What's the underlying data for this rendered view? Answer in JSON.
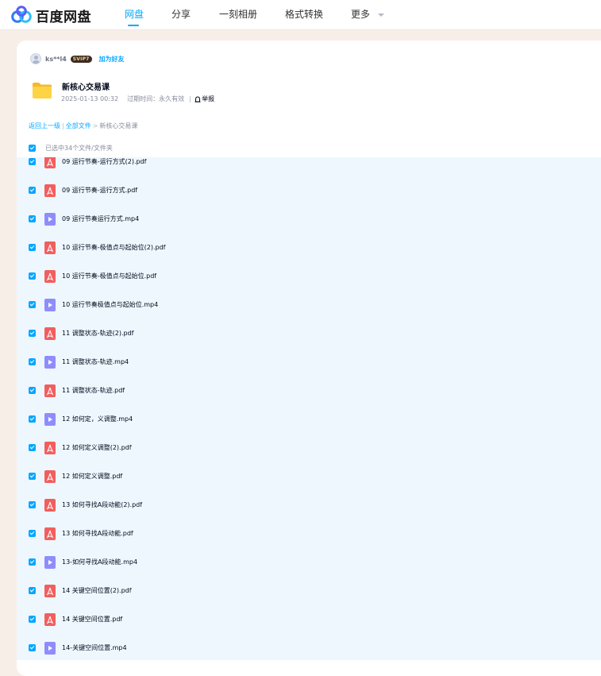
{
  "app": {
    "logo_text": "百度网盘",
    "nav": [
      {
        "label": "网盘",
        "active": true
      },
      {
        "label": "分享",
        "active": false
      },
      {
        "label": "一刻相册",
        "active": false
      },
      {
        "label": "格式转换",
        "active": false
      },
      {
        "label": "更多",
        "active": false
      }
    ]
  },
  "share": {
    "owner": "ks**l4",
    "vip_badge": "SVIP7",
    "add_friend": "加为好友",
    "folder_title": "新核心交易课",
    "date": "2025-01-13 00:32",
    "expiry_label": "过期时间：永久有效",
    "report_label": "举报"
  },
  "breadcrumb": {
    "back": "返回上一级",
    "all_files": "全部文件",
    "current": "新核心交易课"
  },
  "selection": {
    "text": "已选中34个文件/文件夹"
  },
  "colors": {
    "accent": "#06a7ff",
    "pdf_icon": "#f25e5e",
    "video_icon": "#8f8dfc",
    "list_bg": "#eef7fe",
    "page_bg": "#f7eee8"
  },
  "files": [
    {
      "name": "09 运行节奏-运行方式(2).pdf",
      "type": "pdf",
      "checked": true
    },
    {
      "name": "09 运行节奏-运行方式.pdf",
      "type": "pdf",
      "checked": true
    },
    {
      "name": "09 运行节奏运行方式.mp4",
      "type": "video",
      "checked": true
    },
    {
      "name": "10 运行节奏-极值点与起始位(2).pdf",
      "type": "pdf",
      "checked": true
    },
    {
      "name": "10 运行节奏-极值点与起始位.pdf",
      "type": "pdf",
      "checked": true
    },
    {
      "name": "10 运行节奏极值点与起始位.mp4",
      "type": "video",
      "checked": true
    },
    {
      "name": "11 调整状态-轨迹(2).pdf",
      "type": "pdf",
      "checked": true
    },
    {
      "name": "11 调整状态-轨迹.mp4",
      "type": "video",
      "checked": true
    },
    {
      "name": "11 调整状态-轨迹.pdf",
      "type": "pdf",
      "checked": true
    },
    {
      "name": "12 如何定，义调整.mp4",
      "type": "video",
      "checked": true
    },
    {
      "name": "12 如何定义调整(2).pdf",
      "type": "pdf",
      "checked": true
    },
    {
      "name": "12 如何定义调整.pdf",
      "type": "pdf",
      "checked": true
    },
    {
      "name": "13 如何寻找A段动能(2).pdf",
      "type": "pdf",
      "checked": true
    },
    {
      "name": "13 如何寻找A段动能.pdf",
      "type": "pdf",
      "checked": true
    },
    {
      "name": "13-如何寻找A段动能.mp4",
      "type": "video",
      "checked": true
    },
    {
      "name": "14 关键空间位置(2).pdf",
      "type": "pdf",
      "checked": true
    },
    {
      "name": "14 关键空间位置.pdf",
      "type": "pdf",
      "checked": true
    },
    {
      "name": "14-关键空间位置.mp4",
      "type": "video",
      "checked": true
    }
  ]
}
